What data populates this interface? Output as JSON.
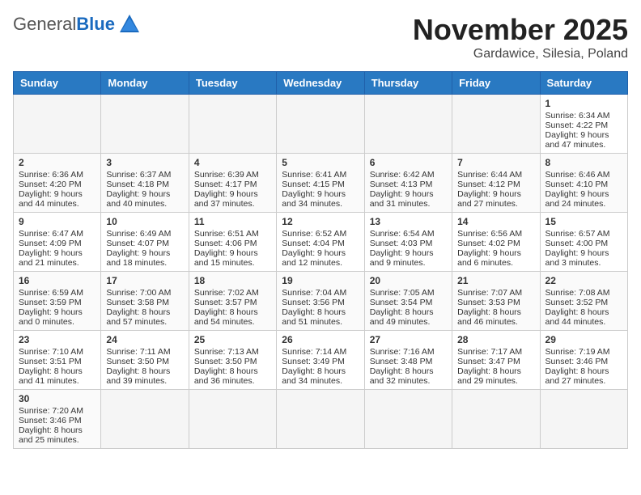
{
  "header": {
    "logo_general": "General",
    "logo_blue": "Blue",
    "month": "November 2025",
    "location": "Gardawice, Silesia, Poland"
  },
  "weekdays": [
    "Sunday",
    "Monday",
    "Tuesday",
    "Wednesday",
    "Thursday",
    "Friday",
    "Saturday"
  ],
  "weeks": [
    [
      {
        "day": "",
        "empty": true
      },
      {
        "day": "",
        "empty": true
      },
      {
        "day": "",
        "empty": true
      },
      {
        "day": "",
        "empty": true
      },
      {
        "day": "",
        "empty": true
      },
      {
        "day": "",
        "empty": true
      },
      {
        "day": "1",
        "sunrise": "6:34 AM",
        "sunset": "4:22 PM",
        "daylight": "9 hours and 47 minutes."
      }
    ],
    [
      {
        "day": "2",
        "sunrise": "6:36 AM",
        "sunset": "4:20 PM",
        "daylight": "9 hours and 44 minutes."
      },
      {
        "day": "3",
        "sunrise": "6:37 AM",
        "sunset": "4:18 PM",
        "daylight": "9 hours and 40 minutes."
      },
      {
        "day": "4",
        "sunrise": "6:39 AM",
        "sunset": "4:17 PM",
        "daylight": "9 hours and 37 minutes."
      },
      {
        "day": "5",
        "sunrise": "6:41 AM",
        "sunset": "4:15 PM",
        "daylight": "9 hours and 34 minutes."
      },
      {
        "day": "6",
        "sunrise": "6:42 AM",
        "sunset": "4:13 PM",
        "daylight": "9 hours and 31 minutes."
      },
      {
        "day": "7",
        "sunrise": "6:44 AM",
        "sunset": "4:12 PM",
        "daylight": "9 hours and 27 minutes."
      },
      {
        "day": "8",
        "sunrise": "6:46 AM",
        "sunset": "4:10 PM",
        "daylight": "9 hours and 24 minutes."
      }
    ],
    [
      {
        "day": "9",
        "sunrise": "6:47 AM",
        "sunset": "4:09 PM",
        "daylight": "9 hours and 21 minutes."
      },
      {
        "day": "10",
        "sunrise": "6:49 AM",
        "sunset": "4:07 PM",
        "daylight": "9 hours and 18 minutes."
      },
      {
        "day": "11",
        "sunrise": "6:51 AM",
        "sunset": "4:06 PM",
        "daylight": "9 hours and 15 minutes."
      },
      {
        "day": "12",
        "sunrise": "6:52 AM",
        "sunset": "4:04 PM",
        "daylight": "9 hours and 12 minutes."
      },
      {
        "day": "13",
        "sunrise": "6:54 AM",
        "sunset": "4:03 PM",
        "daylight": "9 hours and 9 minutes."
      },
      {
        "day": "14",
        "sunrise": "6:56 AM",
        "sunset": "4:02 PM",
        "daylight": "9 hours and 6 minutes."
      },
      {
        "day": "15",
        "sunrise": "6:57 AM",
        "sunset": "4:00 PM",
        "daylight": "9 hours and 3 minutes."
      }
    ],
    [
      {
        "day": "16",
        "sunrise": "6:59 AM",
        "sunset": "3:59 PM",
        "daylight": "9 hours and 0 minutes."
      },
      {
        "day": "17",
        "sunrise": "7:00 AM",
        "sunset": "3:58 PM",
        "daylight": "8 hours and 57 minutes."
      },
      {
        "day": "18",
        "sunrise": "7:02 AM",
        "sunset": "3:57 PM",
        "daylight": "8 hours and 54 minutes."
      },
      {
        "day": "19",
        "sunrise": "7:04 AM",
        "sunset": "3:56 PM",
        "daylight": "8 hours and 51 minutes."
      },
      {
        "day": "20",
        "sunrise": "7:05 AM",
        "sunset": "3:54 PM",
        "daylight": "8 hours and 49 minutes."
      },
      {
        "day": "21",
        "sunrise": "7:07 AM",
        "sunset": "3:53 PM",
        "daylight": "8 hours and 46 minutes."
      },
      {
        "day": "22",
        "sunrise": "7:08 AM",
        "sunset": "3:52 PM",
        "daylight": "8 hours and 44 minutes."
      }
    ],
    [
      {
        "day": "23",
        "sunrise": "7:10 AM",
        "sunset": "3:51 PM",
        "daylight": "8 hours and 41 minutes."
      },
      {
        "day": "24",
        "sunrise": "7:11 AM",
        "sunset": "3:50 PM",
        "daylight": "8 hours and 39 minutes."
      },
      {
        "day": "25",
        "sunrise": "7:13 AM",
        "sunset": "3:50 PM",
        "daylight": "8 hours and 36 minutes."
      },
      {
        "day": "26",
        "sunrise": "7:14 AM",
        "sunset": "3:49 PM",
        "daylight": "8 hours and 34 minutes."
      },
      {
        "day": "27",
        "sunrise": "7:16 AM",
        "sunset": "3:48 PM",
        "daylight": "8 hours and 32 minutes."
      },
      {
        "day": "28",
        "sunrise": "7:17 AM",
        "sunset": "3:47 PM",
        "daylight": "8 hours and 29 minutes."
      },
      {
        "day": "29",
        "sunrise": "7:19 AM",
        "sunset": "3:46 PM",
        "daylight": "8 hours and 27 minutes."
      }
    ],
    [
      {
        "day": "30",
        "sunrise": "7:20 AM",
        "sunset": "3:46 PM",
        "daylight": "8 hours and 25 minutes."
      },
      {
        "day": "",
        "empty": true
      },
      {
        "day": "",
        "empty": true
      },
      {
        "day": "",
        "empty": true
      },
      {
        "day": "",
        "empty": true
      },
      {
        "day": "",
        "empty": true
      },
      {
        "day": "",
        "empty": true
      }
    ]
  ],
  "labels": {
    "sunrise": "Sunrise:",
    "sunset": "Sunset:",
    "daylight": "Daylight:"
  }
}
